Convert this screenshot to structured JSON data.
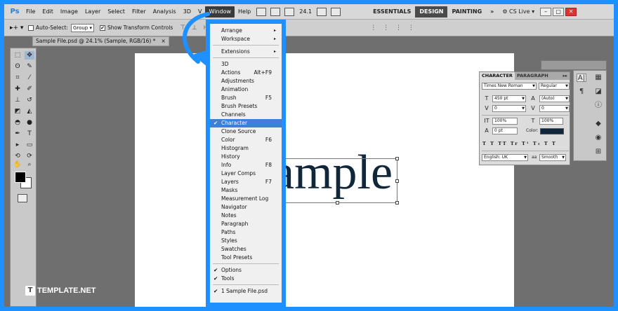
{
  "app": {
    "logo": "Ps"
  },
  "menubar": {
    "items": [
      "File",
      "Edit",
      "Image",
      "Layer",
      "Select",
      "Filter",
      "Analysis",
      "3D",
      "V",
      "Window",
      "Help"
    ],
    "zoom": "24.1",
    "workspaces": [
      "ESSENTIALS",
      "DESIGN",
      "PAINTING"
    ],
    "more": "»",
    "cslive": "CS Live"
  },
  "options": {
    "auto_select_label": "Auto-Select:",
    "auto_select_value": "Group",
    "transform_label": "Show Transform Controls"
  },
  "doc_tab": {
    "title": "Sample File.psd @ 24.1% (Sample, RGB/16) *",
    "close": "×"
  },
  "canvas": {
    "text": "ample"
  },
  "window_menu": {
    "items": [
      {
        "label": "Arrange",
        "shortcut": "",
        "arrow": "▸",
        "check": "",
        "sep_after": false
      },
      {
        "label": "Workspace",
        "shortcut": "",
        "arrow": "▸",
        "check": "",
        "sep_after": true
      },
      {
        "label": "Extensions",
        "shortcut": "",
        "arrow": "▸",
        "check": "",
        "sep_after": true
      },
      {
        "label": "3D",
        "shortcut": "",
        "arrow": "",
        "check": "",
        "sep_after": false
      },
      {
        "label": "Actions",
        "shortcut": "Alt+F9",
        "arrow": "",
        "check": "",
        "sep_after": false
      },
      {
        "label": "Adjustments",
        "shortcut": "",
        "arrow": "",
        "check": "",
        "sep_after": false
      },
      {
        "label": "Animation",
        "shortcut": "",
        "arrow": "",
        "check": "",
        "sep_after": false
      },
      {
        "label": "Brush",
        "shortcut": "F5",
        "arrow": "",
        "check": "",
        "sep_after": false
      },
      {
        "label": "Brush Presets",
        "shortcut": "",
        "arrow": "",
        "check": "",
        "sep_after": false
      },
      {
        "label": "Channels",
        "shortcut": "",
        "arrow": "",
        "check": "",
        "sep_after": false
      },
      {
        "label": "Character",
        "shortcut": "",
        "arrow": "",
        "check": "✔",
        "sep_after": false,
        "highlight": true
      },
      {
        "label": "Clone Source",
        "shortcut": "",
        "arrow": "",
        "check": "",
        "sep_after": false
      },
      {
        "label": "Color",
        "shortcut": "F6",
        "arrow": "",
        "check": "",
        "sep_after": false
      },
      {
        "label": "Histogram",
        "shortcut": "",
        "arrow": "",
        "check": "",
        "sep_after": false
      },
      {
        "label": "History",
        "shortcut": "",
        "arrow": "",
        "check": "",
        "sep_after": false
      },
      {
        "label": "Info",
        "shortcut": "F8",
        "arrow": "",
        "check": "",
        "sep_after": false
      },
      {
        "label": "Layer Comps",
        "shortcut": "",
        "arrow": "",
        "check": "",
        "sep_after": false
      },
      {
        "label": "Layers",
        "shortcut": "F7",
        "arrow": "",
        "check": "",
        "sep_after": false
      },
      {
        "label": "Masks",
        "shortcut": "",
        "arrow": "",
        "check": "",
        "sep_after": false
      },
      {
        "label": "Measurement Log",
        "shortcut": "",
        "arrow": "",
        "check": "",
        "sep_after": false
      },
      {
        "label": "Navigator",
        "shortcut": "",
        "arrow": "",
        "check": "",
        "sep_after": false
      },
      {
        "label": "Notes",
        "shortcut": "",
        "arrow": "",
        "check": "",
        "sep_after": false
      },
      {
        "label": "Paragraph",
        "shortcut": "",
        "arrow": "",
        "check": "",
        "sep_after": false
      },
      {
        "label": "Paths",
        "shortcut": "",
        "arrow": "",
        "check": "",
        "sep_after": false
      },
      {
        "label": "Styles",
        "shortcut": "",
        "arrow": "",
        "check": "",
        "sep_after": false
      },
      {
        "label": "Swatches",
        "shortcut": "",
        "arrow": "",
        "check": "",
        "sep_after": false
      },
      {
        "label": "Tool Presets",
        "shortcut": "",
        "arrow": "",
        "check": "",
        "sep_after": true
      },
      {
        "label": "Options",
        "shortcut": "",
        "arrow": "",
        "check": "✔",
        "sep_after": false
      },
      {
        "label": "Tools",
        "shortcut": "",
        "arrow": "",
        "check": "✔",
        "sep_after": true
      },
      {
        "label": "1 Sample File.psd",
        "shortcut": "",
        "arrow": "",
        "check": "✔",
        "sep_after": false
      }
    ]
  },
  "character_panel": {
    "tabs": [
      "CHARACTER",
      "PARAGRAPH"
    ],
    "menu": "▸▸",
    "font_family": "Times New Roman",
    "font_style": "Regular",
    "font_size": "450 pt",
    "leading": "(Auto)",
    "kerning": "0",
    "tracking": "0",
    "vertical_scale": "100%",
    "horizontal_scale": "100%",
    "baseline_shift": "0 pt",
    "color_label": "Color:",
    "type_styles": "T T TT Tr T¹ T₁ T T",
    "language": "English: UK",
    "aa_label": "aa",
    "antialias": "Smooth"
  },
  "colors": {
    "highlight_border": "#1e90ff",
    "menu_highlight": "#3e7fd8",
    "text_color": "#10263a"
  },
  "watermark": {
    "text": "TEMPLATE.NET",
    "icon": "T"
  }
}
